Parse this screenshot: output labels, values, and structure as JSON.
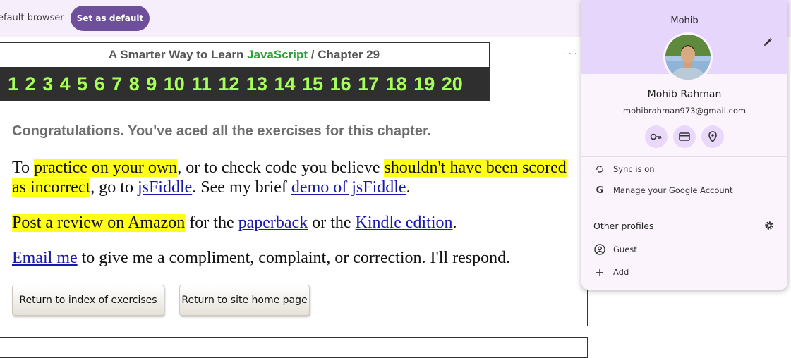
{
  "infobar": {
    "text": "efault browser",
    "button": "Set as default"
  },
  "book": {
    "title_prefix": "A Smarter Way to Learn ",
    "title_js": "JavaScript",
    "title_suffix": "  /  Chapter 29",
    "chapters": [
      "1",
      "2",
      "3",
      "4",
      "5",
      "6",
      "7",
      "8",
      "9",
      "10",
      "11",
      "12",
      "13",
      "14",
      "15",
      "16",
      "17",
      "18",
      "19",
      "20"
    ]
  },
  "content": {
    "congrats": "Congratulations. You've aced all the exercises for this chapter.",
    "p1": {
      "t1": "To ",
      "h1": "practice on your own",
      "t2": ", or to check code you believe ",
      "h2": "shouldn't have been scored as incorrect",
      "t3": ", go to ",
      "l1": "jsFiddle",
      "t4": ". See my brief ",
      "l2": "demo of jsFiddle",
      "t5": "."
    },
    "p2": {
      "h1": "Post a review on Amazon",
      "t1": " for the ",
      "l1": "paperback",
      "t2": " or the ",
      "l2": "Kindle edition",
      "t3": "."
    },
    "p3": {
      "l1": "Email me",
      "t1": " to give me a compliment, complaint, or correction. I'll respond."
    },
    "btn_index": "Return to index of exercises",
    "btn_home": "Return to site home page"
  },
  "profile": {
    "top_name": "Mohib",
    "full_name": "Mohib Rahman",
    "email": "mohibrahman973@gmail.com",
    "sync": "Sync is on",
    "manage": "Manage your Google Account",
    "other_profiles": "Other profiles",
    "guest": "Guest",
    "add": "Add",
    "accent": "#e7d6fb"
  }
}
